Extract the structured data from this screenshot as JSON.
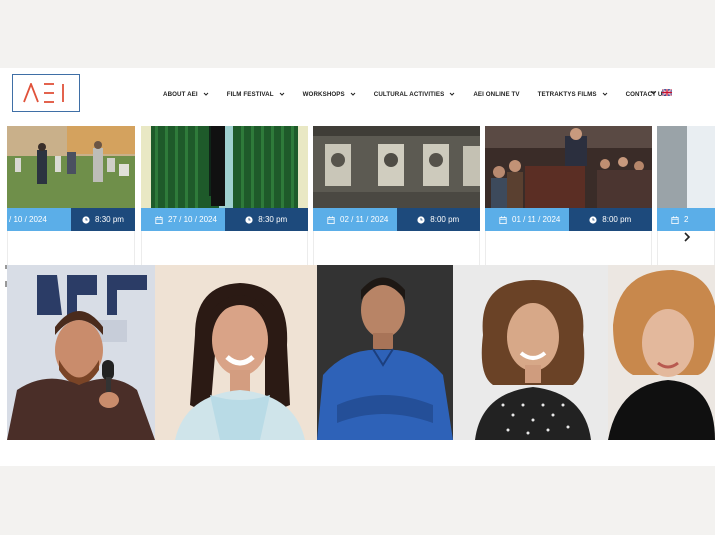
{
  "brand": {
    "logo_text": "AEI",
    "logo_color": "#e0523a",
    "frame_color": "#3f6fa6"
  },
  "nav": [
    {
      "label": "ABOUT AEI",
      "has_dropdown": true
    },
    {
      "label": "FILM FESTIVAL",
      "has_dropdown": true
    },
    {
      "label": "WORKSHOPS",
      "has_dropdown": true
    },
    {
      "label": "CULTURAL ACTIVITIES",
      "has_dropdown": true
    },
    {
      "label": "AEI ONLINE TV",
      "has_dropdown": false
    },
    {
      "label": "TETRAKTYS FILMS",
      "has_dropdown": true
    },
    {
      "label": "CONTACT US",
      "has_dropdown": false
    }
  ],
  "language": {
    "icon": "uk-flag-icon"
  },
  "events": [
    {
      "date": "/ 10 / 2024",
      "time": "8:30 pm"
    },
    {
      "date": "27 / 10 / 2024",
      "time": "8:30 pm"
    },
    {
      "date": "02 / 11 / 2024",
      "time": "8:00 pm"
    },
    {
      "date": "01 / 11 / 2024",
      "time": "8:00 pm"
    },
    {
      "date": "2",
      "time": ""
    }
  ],
  "colors": {
    "date_bg": "#5baee8",
    "time_bg": "#1d4a7c"
  }
}
